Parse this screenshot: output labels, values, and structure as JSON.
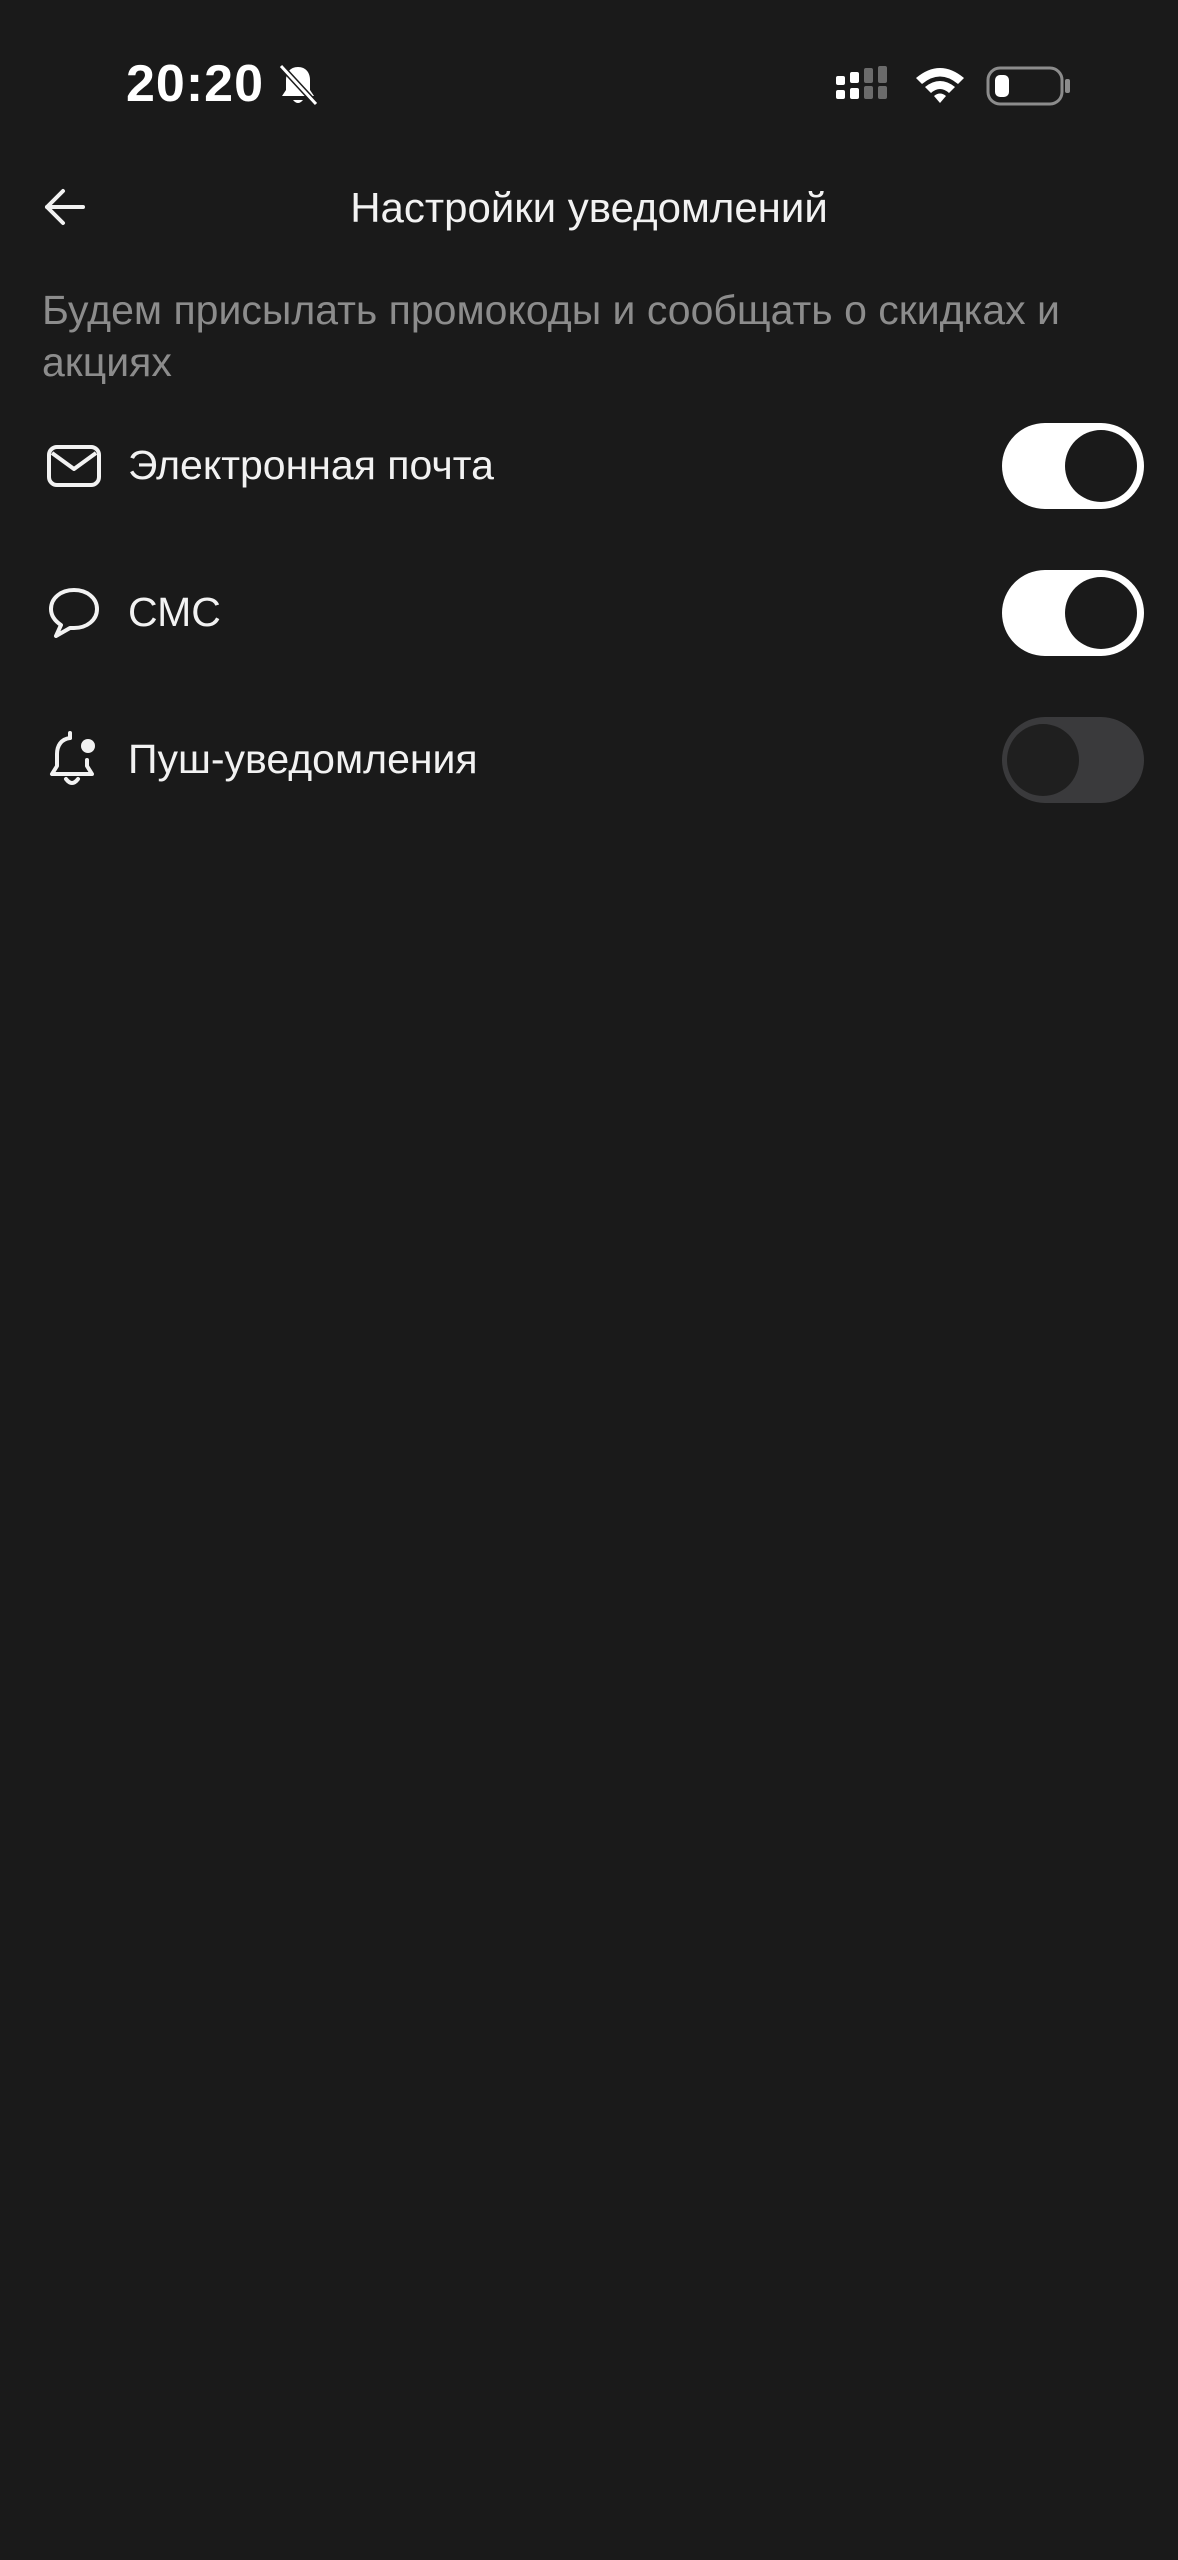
{
  "status_bar": {
    "time": "20:20",
    "icons": [
      "bell-muted-icon",
      "signal-icon",
      "wifi-icon",
      "battery-icon"
    ]
  },
  "header": {
    "title": "Настройки уведомлений",
    "back_icon": "arrow-left-icon"
  },
  "subtitle": "Будем присылать промокоды и сообщать о скидках и акциях",
  "settings": [
    {
      "label": "Электронная почта",
      "icon": "mail-icon",
      "enabled": true
    },
    {
      "label": "СМС",
      "icon": "chat-bubble-icon",
      "enabled": true
    },
    {
      "label": "Пуш-уведомления",
      "icon": "bell-dot-icon",
      "enabled": false
    }
  ],
  "colors": {
    "background": "#1a1a1a",
    "text": "#f2f2f2",
    "muted_text": "#8c8c8c",
    "toggle_on": "#ffffff",
    "toggle_off": "#3a3a3c"
  }
}
